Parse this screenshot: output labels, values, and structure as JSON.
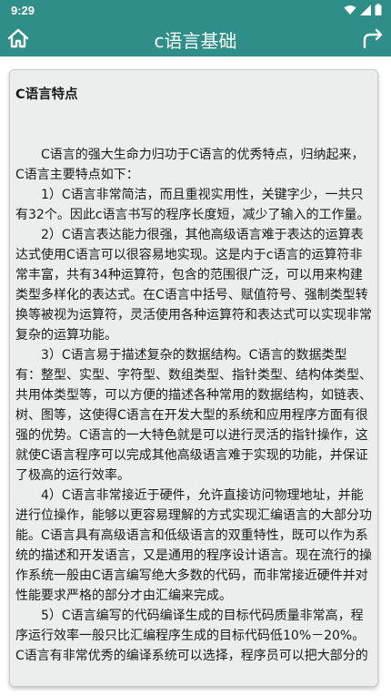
{
  "status_bar": {
    "time": "9:29"
  },
  "app_bar": {
    "title": "c语言基础",
    "home_icon": "home-icon",
    "share_icon": "share-icon"
  },
  "article": {
    "heading": "C语言特点",
    "paragraphs": [
      "C语言的强大生命力归功于C语言的优秀特点，归纳起来，C语言主要特点如下：",
      "1）C语言非常简洁，而且重视实用性，关键字少，一共只有32个。因此c语言书写的程序长度短，减少了输入的工作量。",
      "2）C语言表达能力很强，其他高级语言难于表达的运算表达式使用C语言可以很容易地实现。这是内于c语言的运算符非常丰富，共有34种运算符，包含的范围很广泛，可以用来构建类型多样化的表达式。在C语言中括号、赋值符号、强制类型转换等被视为运算符，灵活使用各种运算符和表达式可以实现非常复杂的运算功能。",
      "3）C语言易于描述复杂的数据结构。C语言的数据类型有：整型、实型、字符型、数组类型、指针类型、结构体类型、共用体类型等，可以方便的描述各种常用的数据结构，如链表、树、图等，这使得C语言在开发大型的系统和应用程序方面有很强的优势。C语言的一大特色就是可以进行灵活的指针操作，这就使C语言程序可以完成其他高级语言难于实现的功能，并保证了极高的运行效率。",
      "4）C语言非常接近于硬件，允许直接访问物理地址，并能进行位操作，能够以更容易理解的方式实现汇编语言的大部分功能。C语言具有高级语言和低级语言的双重特性，既可以作为系统的描述和开发语言，又是通用的程序设计语言。现在流行的操作系统一般由C语言编写绝大多数的代码，而非常接近硬件并对性能要求严格的部分才由汇编来完成。",
      "5）C语言编写的代码编译生成的目标代码质量非常高，程序运行效率一般只比汇编程序生成的目标代码低10%－20%。C语言有非常优秀的编译系统可以选择，程序员可以把大部分的"
    ]
  },
  "colors": {
    "primary": "#2f8f88",
    "card_bg": "#eceeee",
    "text": "#1a1a1a"
  }
}
